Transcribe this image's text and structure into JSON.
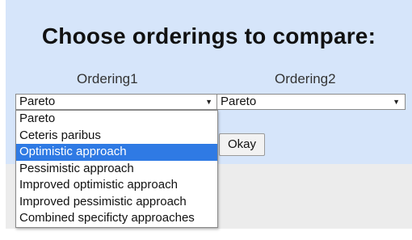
{
  "title": "Choose orderings to compare:",
  "ordering1": {
    "label": "Ordering1",
    "selected": "Pareto",
    "options": [
      "Pareto",
      "Ceteris paribus",
      "Optimistic approach",
      "Pessimistic approach",
      "Improved optimistic approach",
      "Improved pessimistic approach",
      "Combined specificty approaches"
    ],
    "highlighted_index": 2
  },
  "ordering2": {
    "label": "Ordering2",
    "selected": "Pareto"
  },
  "okay_label": "Okay",
  "colors": {
    "panel": "#d6e5fa",
    "highlight": "#2f7ae4"
  },
  "icons": {
    "select_arrow": "chevron-down-icon"
  }
}
